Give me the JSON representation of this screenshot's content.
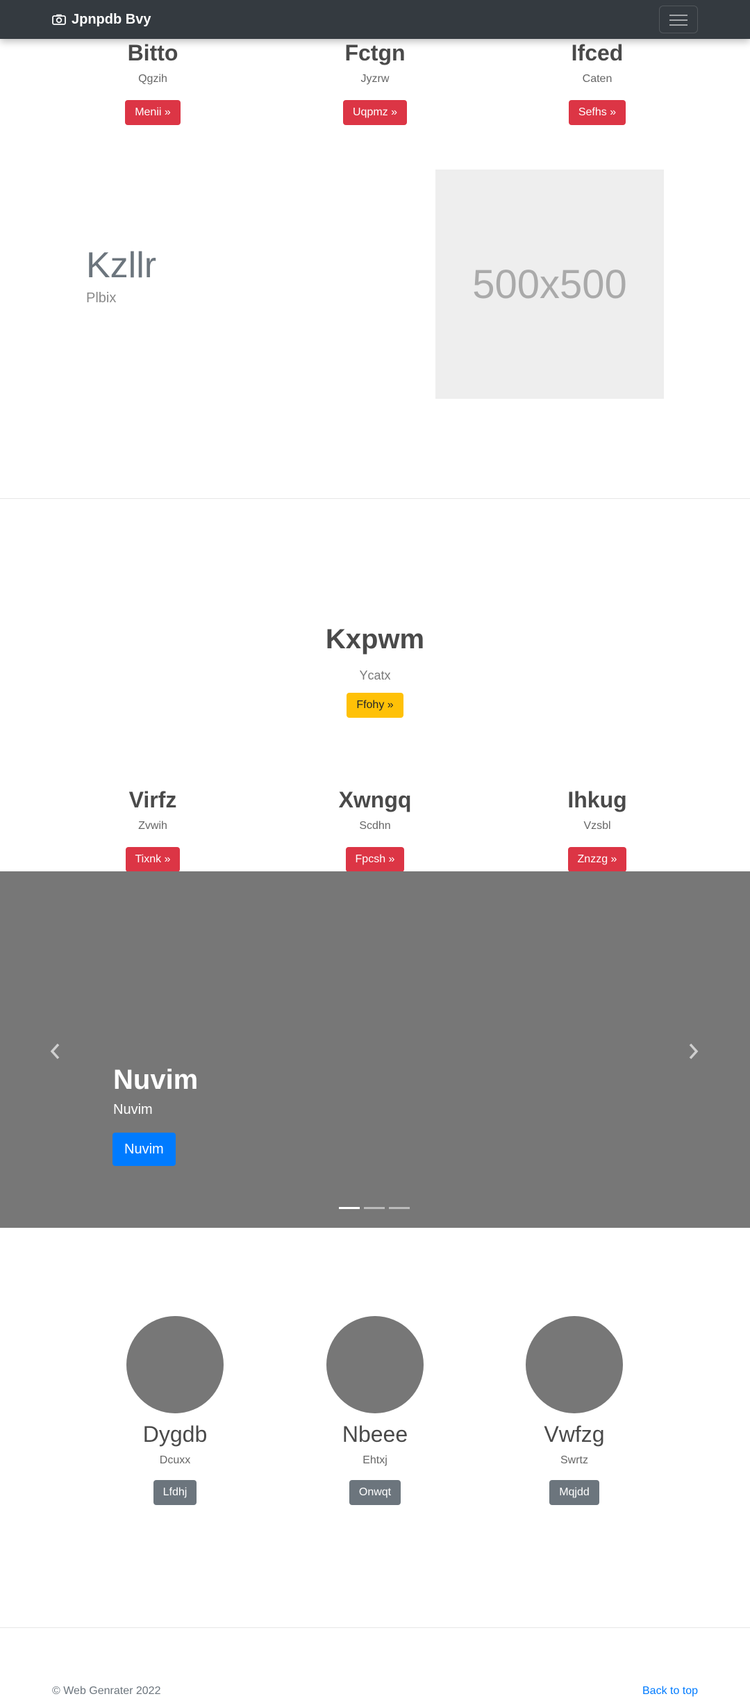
{
  "navbar": {
    "brand": "Jpnpdb Bvy",
    "brand_icon": "camera-icon",
    "toggler_icon": "hamburger-menu-icon"
  },
  "top_columns": [
    {
      "title": "Bitto",
      "subtitle": "Qgzih",
      "button": "Menii »"
    },
    {
      "title": "Fctgn",
      "subtitle": "Jyzrw",
      "button": "Uqpmz »"
    },
    {
      "title": "Ifced",
      "subtitle": "Caten",
      "button": "Sefhs »"
    }
  ],
  "feature": {
    "title": "Kzllr",
    "subtitle": "Plbix",
    "image_text": "500x500"
  },
  "jumbotron": {
    "title": "Kxpwm",
    "subtitle": "Ycatx",
    "button": "Ffohy »"
  },
  "mid_columns": [
    {
      "title": "Virfz",
      "subtitle": "Zvwih",
      "button": "Tixnk »"
    },
    {
      "title": "Xwngq",
      "subtitle": "Scdhn",
      "button": "Fpcsh »"
    },
    {
      "title": "Ihkug",
      "subtitle": "Vzsbl",
      "button": "Znzzg »"
    }
  ],
  "carousel": {
    "title": "Nuvim",
    "subtitle": "Nuvim",
    "button": "Nuvim",
    "prev_icon": "chevron-left-icon",
    "next_icon": "chevron-right-icon",
    "slides": 3,
    "active_slide": 1
  },
  "people": [
    {
      "name": "Dygdb",
      "subtitle": "Dcuxx",
      "button": "Lfdhj"
    },
    {
      "name": "Nbeee",
      "subtitle": "Ehtxj",
      "button": "Onwqt"
    },
    {
      "name": "Vwfzg",
      "subtitle": "Swrtz",
      "button": "Mqjdd"
    }
  ],
  "footer": {
    "copyright": "© Web Genrater 2022",
    "back_to_top": "Back to top"
  },
  "colors": {
    "navbar": "#343a40",
    "danger": "#dc3545",
    "warning": "#ffc107",
    "secondary": "#6c757d",
    "primary": "#007bff",
    "carousel_bg": "#777777"
  }
}
